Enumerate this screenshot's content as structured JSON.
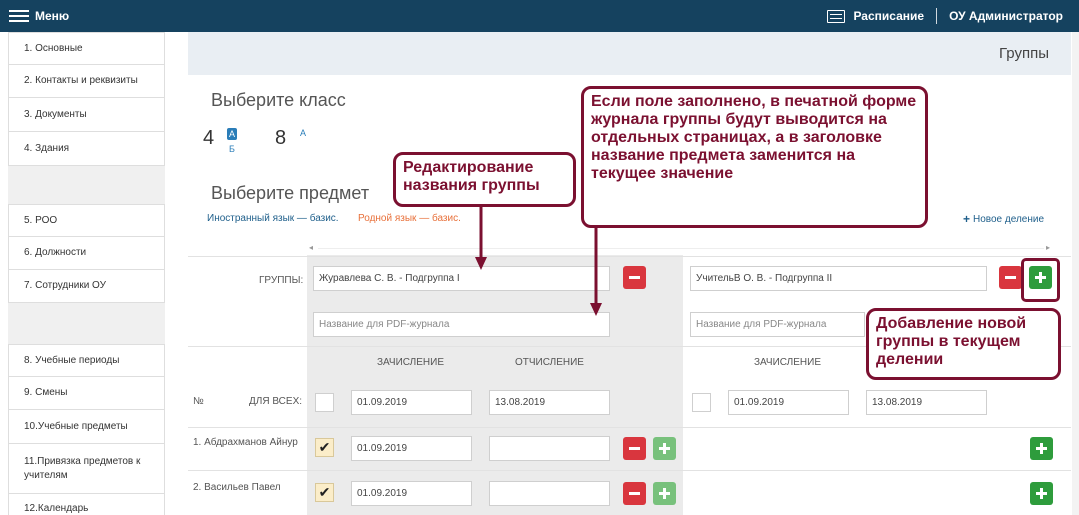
{
  "topbar": {
    "menu_label": "Меню",
    "schedule_label": "Расписание",
    "user_label": "ОУ Администратор",
    "icons": {
      "menu": "hamburger-icon",
      "schedule": "calendar-list-icon"
    }
  },
  "sidebar": {
    "items": [
      "1.  Основные",
      "2.  Контакты и реквизиты",
      "3.  Документы",
      "4.  Здания",
      "5.  РОО",
      "6.  Должности",
      "7.  Сотрудники ОУ",
      "8.  Учебные периоды",
      "9.  Смены",
      "10.Учебные предметы",
      "11.Привязка предметов к учителям",
      "12.Календарь"
    ]
  },
  "page": {
    "title": "Группы"
  },
  "classes": {
    "heading": "Выберите класс",
    "items": [
      {
        "number": "4",
        "letter_selected": "А",
        "letter_other": "Б"
      },
      {
        "number": "8",
        "letter": "А"
      }
    ]
  },
  "subjects": {
    "heading": "Выберите предмет",
    "items": [
      "Иностранный язык — базис.",
      "Родной язык — базис."
    ],
    "colors": {
      "active": "#1f5f8b",
      "other": "#e8703a"
    },
    "new_division": "Новое деление"
  },
  "groups_table": {
    "groups_label": "ГРУППЫ:",
    "num_label": "№",
    "for_all_label": "ДЛЯ ВСЕХ:",
    "enroll_label": "ЗАЧИСЛЕНИЕ",
    "unenroll_label": "ОТЧИСЛЕНИЕ",
    "group1": {
      "name": "Журавлева С. В. - Подгруппа I",
      "pdf_placeholder": "Название для PDF-журнала",
      "enroll_all": "01.09.2019",
      "unenroll_all": "13.08.2019"
    },
    "group2": {
      "name": "УчительВ О. В. - Подгруппа II",
      "pdf_placeholder": "Название для PDF-журнала",
      "enroll_all": "01.09.2019",
      "unenroll_all": "13.08.2019"
    },
    "students": [
      {
        "name": "1. Абдрахманов Айнур",
        "enroll": "01.09.2019",
        "unenroll": "",
        "checked": true
      },
      {
        "name": "2. Васильев Павел",
        "enroll": "01.09.2019",
        "unenroll": "",
        "checked": true
      }
    ]
  },
  "callouts": {
    "edit_name": "Редактирование названия группы",
    "pdf_note": "Если поле заполнено, в печатной форме журнала группы будут выводится на отдельных страницах, а в заголовке название предмета заменится на текущее значение",
    "add_group": "Добавление новой группы в текущем делении",
    "color": "#7b1030"
  }
}
